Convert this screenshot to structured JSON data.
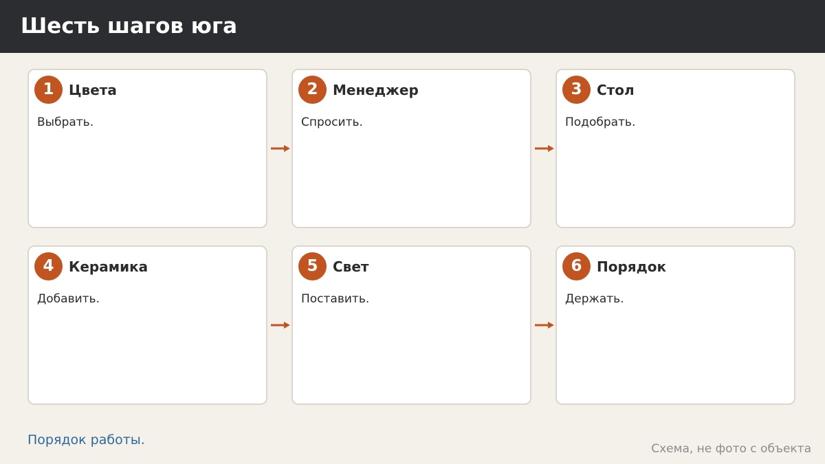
{
  "header": {
    "title": "Шесть шагов юга"
  },
  "steps": [
    {
      "number": "1",
      "title": "Цвета",
      "description": "Выбрать."
    },
    {
      "number": "2",
      "title": "Менеджер",
      "description": "Спросить."
    },
    {
      "number": "3",
      "title": "Стол",
      "description": "Подобрать."
    },
    {
      "number": "4",
      "title": "Керамика",
      "description": "Добавить."
    },
    {
      "number": "5",
      "title": "Свет",
      "description": "Поставить."
    },
    {
      "number": "6",
      "title": "Порядок",
      "description": "Держать."
    }
  ],
  "footer": {
    "caption": "Порядок работы.",
    "note": "Схема, не фото с объекта"
  },
  "colors": {
    "header_bg": "#2b2d31",
    "accent": "#c2541f",
    "page_bg": "#f4f1eb",
    "caption": "#2d6a9a"
  },
  "icons": {
    "connector": "arrow-right-icon"
  }
}
